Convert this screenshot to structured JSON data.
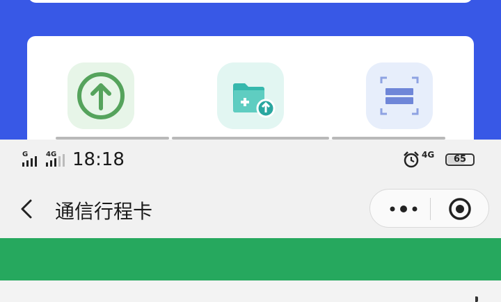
{
  "status_bar": {
    "signal_1_label": "G",
    "signal_2_label": "4G",
    "time": "18:18",
    "alarm_icon": "alarm-clock-icon",
    "network_label": "4G",
    "battery_level": "65"
  },
  "nav": {
    "back_icon": "chevron-left-icon",
    "title": "通信行程卡",
    "more_icon": "more-dots-icon",
    "close_icon": "target-circle-icon"
  },
  "tiles": [
    {
      "icon": "upload-arrow-icon"
    },
    {
      "icon": "folder-upload-icon"
    },
    {
      "icon": "scan-frame-icon"
    }
  ],
  "colors": {
    "header_blue": "#3858e6",
    "footer_green": "#26a85e",
    "upload_green": "#55a35c",
    "folder_teal": "#36b8ad",
    "scan_blue": "#6f86d8"
  }
}
